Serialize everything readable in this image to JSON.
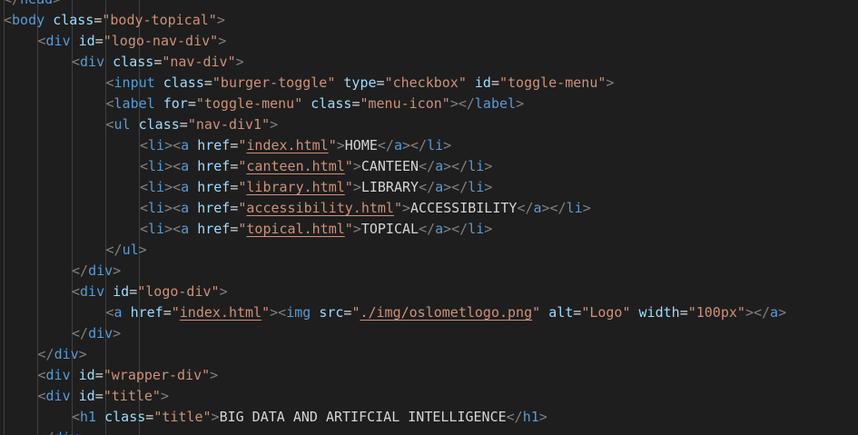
{
  "colors": {
    "background": "#1e1e1e",
    "tag": "#569cd6",
    "punctuation": "#808080",
    "attribute": "#9cdcfe",
    "string": "#ce9178",
    "text": "#d4d4d4"
  },
  "lines": [
    {
      "indent": 0,
      "tokens": [
        {
          "t": "p",
          "v": "</"
        },
        {
          "t": "g",
          "v": "head"
        },
        {
          "t": "p",
          "v": ">"
        }
      ]
    },
    {
      "indent": 0,
      "tokens": [
        {
          "t": "p",
          "v": "<"
        },
        {
          "t": "g",
          "v": "body"
        },
        {
          "t": "x",
          "v": " "
        },
        {
          "t": "a",
          "v": "class"
        },
        {
          "t": "e",
          "v": "="
        },
        {
          "t": "s",
          "v": "\"body-topical\""
        },
        {
          "t": "p",
          "v": ">"
        }
      ]
    },
    {
      "indent": 1,
      "tokens": [
        {
          "t": "p",
          "v": "<"
        },
        {
          "t": "g",
          "v": "div"
        },
        {
          "t": "x",
          "v": " "
        },
        {
          "t": "a",
          "v": "id"
        },
        {
          "t": "e",
          "v": "="
        },
        {
          "t": "s",
          "v": "\"logo-nav-div\""
        },
        {
          "t": "p",
          "v": ">"
        }
      ]
    },
    {
      "indent": 2,
      "tokens": [
        {
          "t": "p",
          "v": "<"
        },
        {
          "t": "g",
          "v": "div"
        },
        {
          "t": "x",
          "v": " "
        },
        {
          "t": "a",
          "v": "class"
        },
        {
          "t": "e",
          "v": "="
        },
        {
          "t": "s",
          "v": "\"nav-div\""
        },
        {
          "t": "p",
          "v": ">"
        }
      ]
    },
    {
      "indent": 3,
      "tokens": [
        {
          "t": "p",
          "v": "<"
        },
        {
          "t": "g",
          "v": "input"
        },
        {
          "t": "x",
          "v": " "
        },
        {
          "t": "a",
          "v": "class"
        },
        {
          "t": "e",
          "v": "="
        },
        {
          "t": "s",
          "v": "\"burger-toggle\""
        },
        {
          "t": "x",
          "v": " "
        },
        {
          "t": "a",
          "v": "type"
        },
        {
          "t": "e",
          "v": "="
        },
        {
          "t": "s",
          "v": "\"checkbox\""
        },
        {
          "t": "x",
          "v": " "
        },
        {
          "t": "a",
          "v": "id"
        },
        {
          "t": "e",
          "v": "="
        },
        {
          "t": "s",
          "v": "\"toggle-menu\""
        },
        {
          "t": "p",
          "v": ">"
        }
      ]
    },
    {
      "indent": 3,
      "tokens": [
        {
          "t": "p",
          "v": "<"
        },
        {
          "t": "g",
          "v": "label"
        },
        {
          "t": "x",
          "v": " "
        },
        {
          "t": "a",
          "v": "for"
        },
        {
          "t": "e",
          "v": "="
        },
        {
          "t": "s",
          "v": "\"toggle-menu\""
        },
        {
          "t": "x",
          "v": " "
        },
        {
          "t": "a",
          "v": "class"
        },
        {
          "t": "e",
          "v": "="
        },
        {
          "t": "s",
          "v": "\"menu-icon\""
        },
        {
          "t": "p",
          "v": "></"
        },
        {
          "t": "g",
          "v": "label"
        },
        {
          "t": "p",
          "v": ">"
        }
      ]
    },
    {
      "indent": 3,
      "tokens": [
        {
          "t": "p",
          "v": "<"
        },
        {
          "t": "g",
          "v": "ul"
        },
        {
          "t": "x",
          "v": " "
        },
        {
          "t": "a",
          "v": "class"
        },
        {
          "t": "e",
          "v": "="
        },
        {
          "t": "s",
          "v": "\"nav-div1\""
        },
        {
          "t": "p",
          "v": ">"
        }
      ]
    },
    {
      "indent": 4,
      "tokens": [
        {
          "t": "p",
          "v": "<"
        },
        {
          "t": "g",
          "v": "li"
        },
        {
          "t": "p",
          "v": "><"
        },
        {
          "t": "g",
          "v": "a"
        },
        {
          "t": "x",
          "v": " "
        },
        {
          "t": "a",
          "v": "href"
        },
        {
          "t": "e",
          "v": "="
        },
        {
          "t": "s",
          "v": "\""
        },
        {
          "t": "l",
          "v": "index.html"
        },
        {
          "t": "s",
          "v": "\""
        },
        {
          "t": "p",
          "v": ">"
        },
        {
          "t": "x",
          "v": "HOME"
        },
        {
          "t": "p",
          "v": "</"
        },
        {
          "t": "g",
          "v": "a"
        },
        {
          "t": "p",
          "v": "></"
        },
        {
          "t": "g",
          "v": "li"
        },
        {
          "t": "p",
          "v": ">"
        }
      ]
    },
    {
      "indent": 4,
      "tokens": [
        {
          "t": "p",
          "v": "<"
        },
        {
          "t": "g",
          "v": "li"
        },
        {
          "t": "p",
          "v": "><"
        },
        {
          "t": "g",
          "v": "a"
        },
        {
          "t": "x",
          "v": " "
        },
        {
          "t": "a",
          "v": "href"
        },
        {
          "t": "e",
          "v": "="
        },
        {
          "t": "s",
          "v": "\""
        },
        {
          "t": "l",
          "v": "canteen.html"
        },
        {
          "t": "s",
          "v": "\""
        },
        {
          "t": "p",
          "v": ">"
        },
        {
          "t": "x",
          "v": "CANTEEN"
        },
        {
          "t": "p",
          "v": "</"
        },
        {
          "t": "g",
          "v": "a"
        },
        {
          "t": "p",
          "v": "></"
        },
        {
          "t": "g",
          "v": "li"
        },
        {
          "t": "p",
          "v": ">"
        }
      ]
    },
    {
      "indent": 4,
      "tokens": [
        {
          "t": "p",
          "v": "<"
        },
        {
          "t": "g",
          "v": "li"
        },
        {
          "t": "p",
          "v": "><"
        },
        {
          "t": "g",
          "v": "a"
        },
        {
          "t": "x",
          "v": " "
        },
        {
          "t": "a",
          "v": "href"
        },
        {
          "t": "e",
          "v": "="
        },
        {
          "t": "s",
          "v": "\""
        },
        {
          "t": "l",
          "v": "library.html"
        },
        {
          "t": "s",
          "v": "\""
        },
        {
          "t": "p",
          "v": ">"
        },
        {
          "t": "x",
          "v": "LIBRARY"
        },
        {
          "t": "p",
          "v": "</"
        },
        {
          "t": "g",
          "v": "a"
        },
        {
          "t": "p",
          "v": "></"
        },
        {
          "t": "g",
          "v": "li"
        },
        {
          "t": "p",
          "v": ">"
        }
      ]
    },
    {
      "indent": 4,
      "tokens": [
        {
          "t": "p",
          "v": "<"
        },
        {
          "t": "g",
          "v": "li"
        },
        {
          "t": "p",
          "v": "><"
        },
        {
          "t": "g",
          "v": "a"
        },
        {
          "t": "x",
          "v": " "
        },
        {
          "t": "a",
          "v": "href"
        },
        {
          "t": "e",
          "v": "="
        },
        {
          "t": "s",
          "v": "\""
        },
        {
          "t": "l",
          "v": "accessibility.html"
        },
        {
          "t": "s",
          "v": "\""
        },
        {
          "t": "p",
          "v": ">"
        },
        {
          "t": "x",
          "v": "ACCESSIBILITY"
        },
        {
          "t": "p",
          "v": "</"
        },
        {
          "t": "g",
          "v": "a"
        },
        {
          "t": "p",
          "v": "></"
        },
        {
          "t": "g",
          "v": "li"
        },
        {
          "t": "p",
          "v": ">"
        }
      ]
    },
    {
      "indent": 4,
      "tokens": [
        {
          "t": "p",
          "v": "<"
        },
        {
          "t": "g",
          "v": "li"
        },
        {
          "t": "p",
          "v": "><"
        },
        {
          "t": "g",
          "v": "a"
        },
        {
          "t": "x",
          "v": " "
        },
        {
          "t": "a",
          "v": "href"
        },
        {
          "t": "e",
          "v": "="
        },
        {
          "t": "s",
          "v": "\""
        },
        {
          "t": "l",
          "v": "topical.html"
        },
        {
          "t": "s",
          "v": "\""
        },
        {
          "t": "p",
          "v": ">"
        },
        {
          "t": "x",
          "v": "TOPICAL"
        },
        {
          "t": "p",
          "v": "</"
        },
        {
          "t": "g",
          "v": "a"
        },
        {
          "t": "p",
          "v": "></"
        },
        {
          "t": "g",
          "v": "li"
        },
        {
          "t": "p",
          "v": ">"
        }
      ]
    },
    {
      "indent": 3,
      "tokens": [
        {
          "t": "p",
          "v": "</"
        },
        {
          "t": "g",
          "v": "ul"
        },
        {
          "t": "p",
          "v": ">"
        }
      ]
    },
    {
      "indent": 2,
      "tokens": [
        {
          "t": "p",
          "v": "</"
        },
        {
          "t": "g",
          "v": "div"
        },
        {
          "t": "p",
          "v": ">"
        }
      ]
    },
    {
      "indent": 2,
      "tokens": [
        {
          "t": "p",
          "v": "<"
        },
        {
          "t": "g",
          "v": "div"
        },
        {
          "t": "x",
          "v": " "
        },
        {
          "t": "a",
          "v": "id"
        },
        {
          "t": "e",
          "v": "="
        },
        {
          "t": "s",
          "v": "\"logo-div\""
        },
        {
          "t": "p",
          "v": ">"
        }
      ]
    },
    {
      "indent": 3,
      "tokens": [
        {
          "t": "p",
          "v": "<"
        },
        {
          "t": "g",
          "v": "a"
        },
        {
          "t": "x",
          "v": " "
        },
        {
          "t": "a",
          "v": "href"
        },
        {
          "t": "e",
          "v": "="
        },
        {
          "t": "s",
          "v": "\""
        },
        {
          "t": "l",
          "v": "index.html"
        },
        {
          "t": "s",
          "v": "\""
        },
        {
          "t": "p",
          "v": "><"
        },
        {
          "t": "g",
          "v": "img"
        },
        {
          "t": "x",
          "v": " "
        },
        {
          "t": "a",
          "v": "src"
        },
        {
          "t": "e",
          "v": "="
        },
        {
          "t": "s",
          "v": "\""
        },
        {
          "t": "l",
          "v": "./img/oslometlogo.png"
        },
        {
          "t": "s",
          "v": "\""
        },
        {
          "t": "x",
          "v": " "
        },
        {
          "t": "a",
          "v": "alt"
        },
        {
          "t": "e",
          "v": "="
        },
        {
          "t": "s",
          "v": "\"Logo\""
        },
        {
          "t": "x",
          "v": " "
        },
        {
          "t": "a",
          "v": "width"
        },
        {
          "t": "e",
          "v": "="
        },
        {
          "t": "s",
          "v": "\"100px\""
        },
        {
          "t": "p",
          "v": "></"
        },
        {
          "t": "g",
          "v": "a"
        },
        {
          "t": "p",
          "v": ">"
        }
      ]
    },
    {
      "indent": 2,
      "tokens": [
        {
          "t": "p",
          "v": "</"
        },
        {
          "t": "g",
          "v": "div"
        },
        {
          "t": "p",
          "v": ">"
        }
      ]
    },
    {
      "indent": 1,
      "tokens": [
        {
          "t": "p",
          "v": "</"
        },
        {
          "t": "g",
          "v": "div"
        },
        {
          "t": "p",
          "v": ">"
        }
      ]
    },
    {
      "indent": 1,
      "tokens": [
        {
          "t": "p",
          "v": "<"
        },
        {
          "t": "g",
          "v": "div"
        },
        {
          "t": "x",
          "v": " "
        },
        {
          "t": "a",
          "v": "id"
        },
        {
          "t": "e",
          "v": "="
        },
        {
          "t": "s",
          "v": "\"wrapper-div\""
        },
        {
          "t": "p",
          "v": ">"
        }
      ]
    },
    {
      "indent": 1,
      "tokens": [
        {
          "t": "p",
          "v": "<"
        },
        {
          "t": "g",
          "v": "div"
        },
        {
          "t": "x",
          "v": " "
        },
        {
          "t": "a",
          "v": "id"
        },
        {
          "t": "e",
          "v": "="
        },
        {
          "t": "s",
          "v": "\"title\""
        },
        {
          "t": "p",
          "v": ">"
        }
      ]
    },
    {
      "indent": 2,
      "tokens": [
        {
          "t": "p",
          "v": "<"
        },
        {
          "t": "g",
          "v": "h1"
        },
        {
          "t": "x",
          "v": " "
        },
        {
          "t": "a",
          "v": "class"
        },
        {
          "t": "e",
          "v": "="
        },
        {
          "t": "s",
          "v": "\"title\""
        },
        {
          "t": "p",
          "v": ">"
        },
        {
          "t": "x",
          "v": "BIG DATA AND ARTIFCIAL INTELLIGENCE"
        },
        {
          "t": "p",
          "v": "</"
        },
        {
          "t": "g",
          "v": "h1"
        },
        {
          "t": "p",
          "v": ">"
        }
      ]
    },
    {
      "indent": 1,
      "tokens": [
        {
          "t": "p",
          "v": "</"
        },
        {
          "t": "g",
          "v": "div"
        },
        {
          "t": "p",
          "v": ">"
        }
      ]
    }
  ]
}
